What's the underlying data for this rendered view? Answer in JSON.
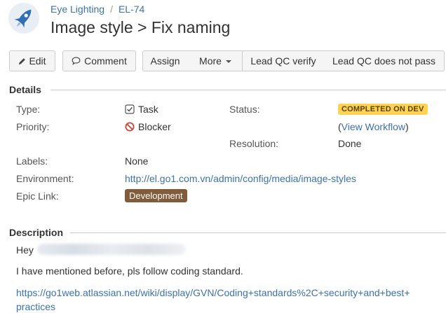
{
  "header": {
    "project": "Eye Lighting",
    "separator": "/",
    "issue_key": "EL-74",
    "title": "Image style > Fix naming"
  },
  "toolbar": {
    "edit": "Edit",
    "comment": "Comment",
    "assign": "Assign",
    "more": "More",
    "lead_qc_verify": "Lead QC verify",
    "lead_qc_not_pass": "Lead QC does not pass"
  },
  "details": {
    "heading": "Details",
    "type_label": "Type:",
    "type_value": "Task",
    "priority_label": "Priority:",
    "priority_value": "Blocker",
    "labels_label": "Labels:",
    "labels_value": "None",
    "environment_label": "Environment:",
    "environment_value": "http://el.go1.com.vn/admin/config/media/image-styles",
    "epic_label": "Epic Link:",
    "epic_value": "Development",
    "status_label": "Status:",
    "status_value": "COMPLETED ON DEV",
    "workflow_open": "(",
    "workflow_link": "View Workflow",
    "workflow_close": ")",
    "resolution_label": "Resolution:",
    "resolution_value": "Done"
  },
  "description": {
    "heading": "Description",
    "greeting": "Hey",
    "line1": "I have mentioned before, pls follow coding standard.",
    "link_line1": "https://go1web.atlassian.net/wiki/display/GVN/Coding+standards%2C+security+and+best+",
    "link_line2": "practices"
  },
  "colors": {
    "link": "#3b73af",
    "status_lozenge_bg": "#ffd351",
    "epic_lozenge_bg": "#815b3a",
    "blocker_red": "#d04437"
  }
}
